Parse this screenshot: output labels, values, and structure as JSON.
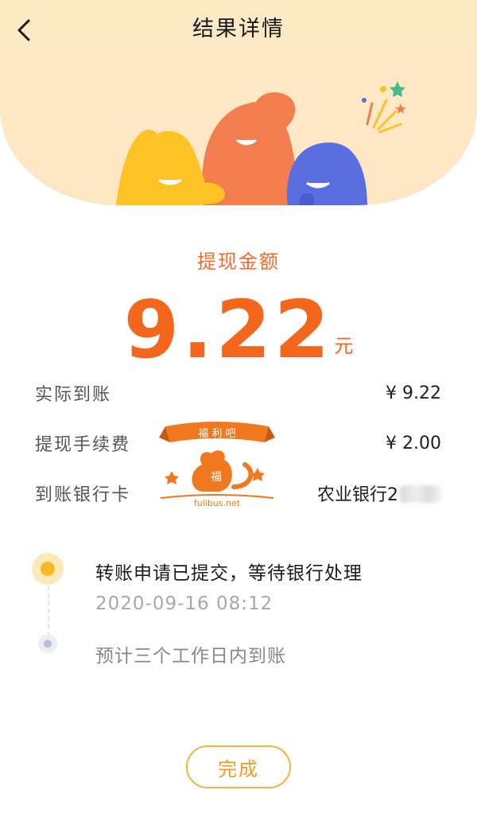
{
  "header": {
    "title": "结果详情",
    "back_icon": "chevron-left-icon"
  },
  "amount_section": {
    "label": "提现金额",
    "value": "9.22",
    "unit": "元"
  },
  "details": [
    {
      "key": "实际到账",
      "value": "¥ 9.22"
    },
    {
      "key": "提现手续费",
      "value": "¥ 2.00"
    },
    {
      "key": "到账银行卡",
      "value": "农业银行2"
    }
  ],
  "watermark": {
    "banner_text": "福 利 吧",
    "center_char": "福",
    "url_text": "fulibus.net"
  },
  "timeline": [
    {
      "text": "转账申请已提交，等待银行处理",
      "time": "2020-09-16  08:12",
      "status": "active"
    },
    {
      "text": "预计三个工作日内到账",
      "status": "pending"
    }
  ],
  "footer": {
    "done_label": "完成"
  },
  "colors": {
    "accent_orange": "#f4661b",
    "button_border": "#f6b23b",
    "hero_bg": "#fde9c4"
  }
}
